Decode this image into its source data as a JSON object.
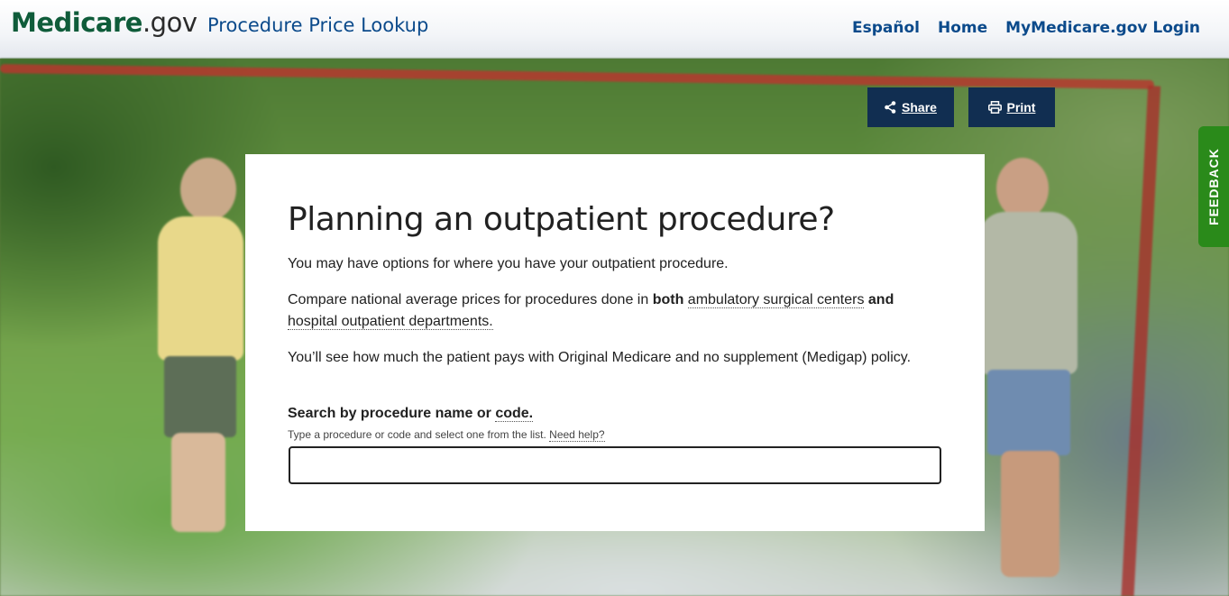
{
  "header": {
    "logo_brand": "Medicare",
    "logo_suffix": ".gov",
    "app_title": "Procedure Price Lookup",
    "nav": [
      "Español",
      "Home",
      "MyMedicare.gov Login"
    ]
  },
  "actions": {
    "share_label": "Share",
    "print_label": "Print"
  },
  "feedback_label": "FEEDBACK",
  "card": {
    "heading": "Planning an outpatient procedure?",
    "p1": "You may have options for where you have your outpatient procedure.",
    "p2_prefix": "Compare national average prices for procedures done in ",
    "p2_bold1": "both",
    "p2_link1": "ambulatory surgical centers",
    "p2_bold2": "and",
    "p2_link2": "hospital outpatient departments.",
    "p3": "You’ll see how much the patient pays with Original Medicare and no supplement (Medigap) policy.",
    "search_label_prefix": "Search by procedure name or ",
    "search_label_link": "code.",
    "search_hint": "Type a procedure or code and select one from the list.",
    "search_help": "Need help?",
    "search_value": ""
  },
  "colors": {
    "navy": "#112e51",
    "link_blue": "#0b4a8b",
    "brand_green": "#0f5c3a",
    "feedback_green": "#2a8a1a"
  }
}
